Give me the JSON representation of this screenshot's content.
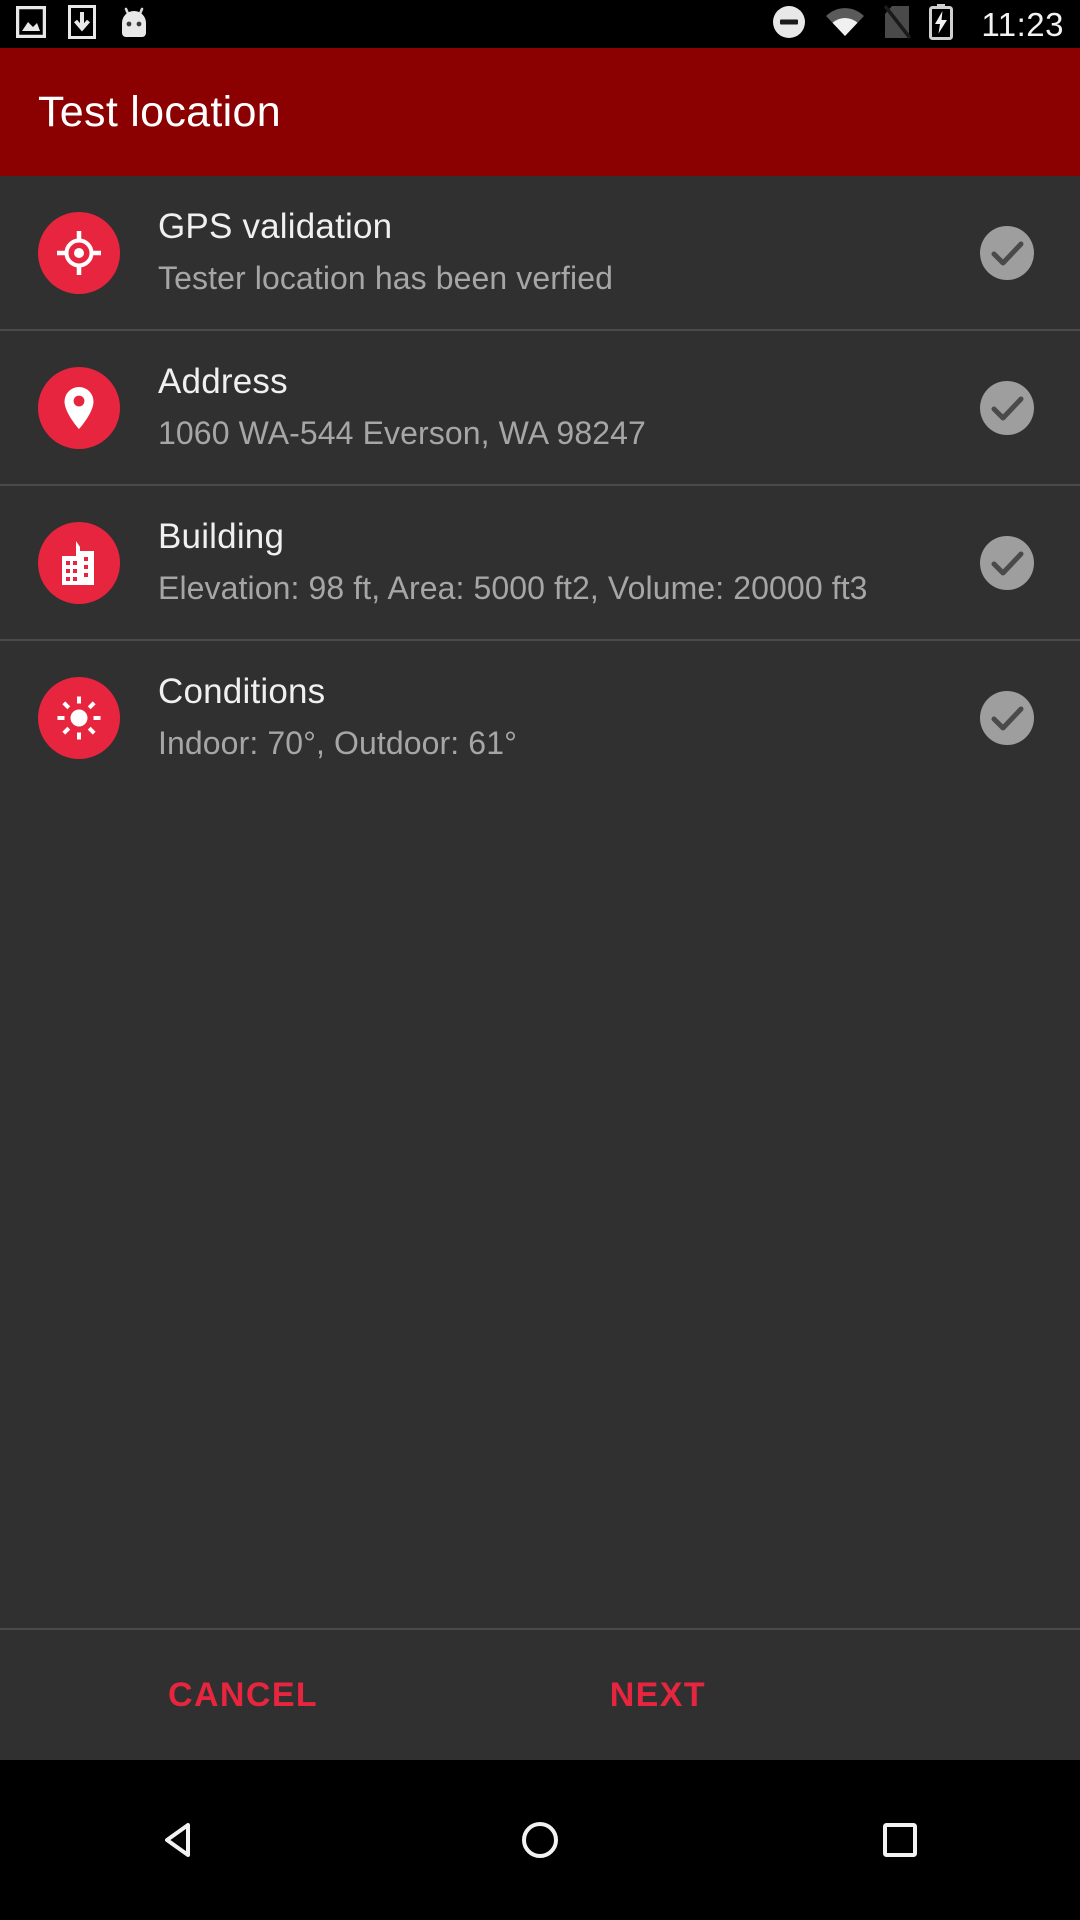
{
  "status_bar": {
    "clock": "11:23",
    "left_icons": [
      "screenshot-icon",
      "download-icon",
      "android-icon"
    ],
    "right_icons": [
      "do-not-disturb-icon",
      "wifi-icon",
      "no-sim-icon",
      "battery-charging-icon"
    ]
  },
  "app_bar": {
    "title": "Test location",
    "background": "#8b0000"
  },
  "theme": {
    "accent": "#e8253f",
    "background": "#303030",
    "divider": "#4a4a4a",
    "check": "#9e9e9e"
  },
  "list": {
    "items": [
      {
        "icon": "gps-crosshair-icon",
        "title": "GPS validation",
        "subtitle": "Tester location has been verfied",
        "status": "verified"
      },
      {
        "icon": "map-pin-icon",
        "title": "Address",
        "subtitle": "1060 WA-544 Everson, WA 98247",
        "status": "verified"
      },
      {
        "icon": "building-icon",
        "title": "Building",
        "subtitle": "Elevation: 98 ft, Area: 5000 ft2, Volume: 20000 ft3",
        "status": "verified"
      },
      {
        "icon": "sun-icon",
        "title": "Conditions",
        "subtitle": "Indoor: 70°, Outdoor: 61°",
        "status": "verified"
      }
    ]
  },
  "actions": {
    "cancel_label": "CANCEL",
    "next_label": "NEXT"
  },
  "nav_bar": {
    "back": "back-triangle-icon",
    "home": "home-circle-icon",
    "recents": "recents-square-icon"
  }
}
